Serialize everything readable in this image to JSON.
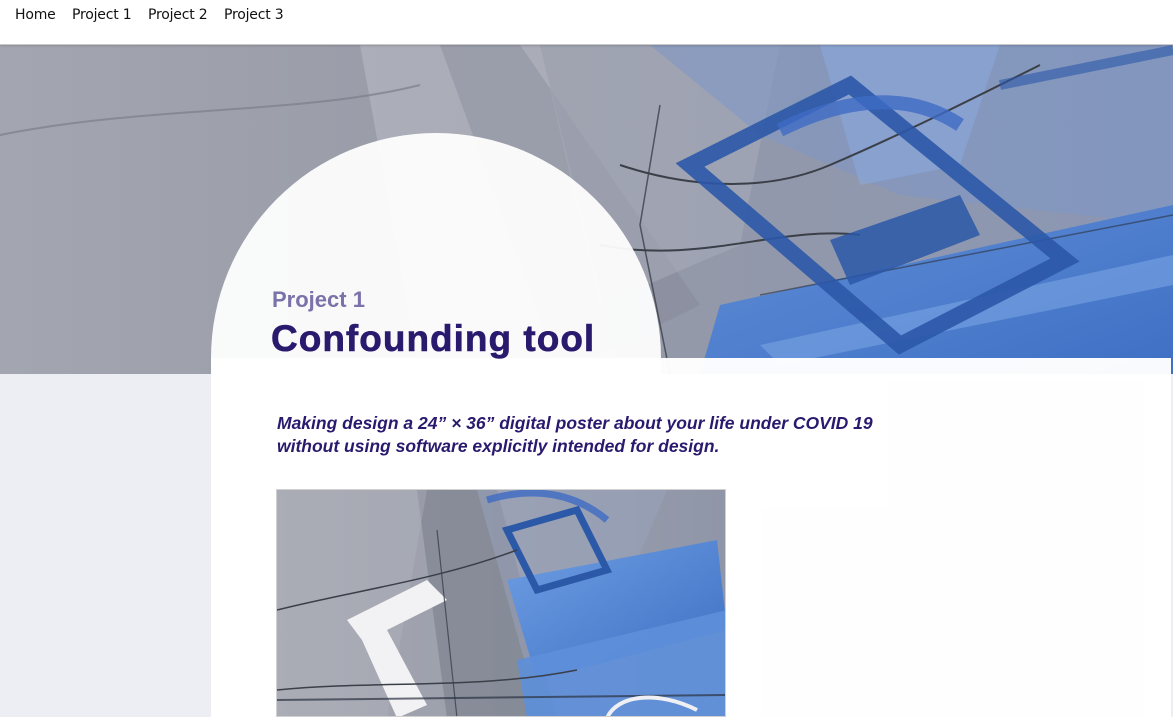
{
  "nav": {
    "items": [
      {
        "label": "Home"
      },
      {
        "label": "Project 1"
      },
      {
        "label": "Project 2"
      },
      {
        "label": "Project 3"
      }
    ]
  },
  "header": {
    "eyebrow": "Project 1",
    "title": "Confounding tool"
  },
  "main": {
    "description_lines": [
      "Making design a 24” × 36” digital poster about your life under COVID 19",
      "without using software explicitly intended for design."
    ]
  },
  "colors": {
    "title": "#2a1a6e",
    "eyebrow": "#7a72a8",
    "accent_blue": "#3a63b8",
    "page_bg": "#eceef3"
  }
}
